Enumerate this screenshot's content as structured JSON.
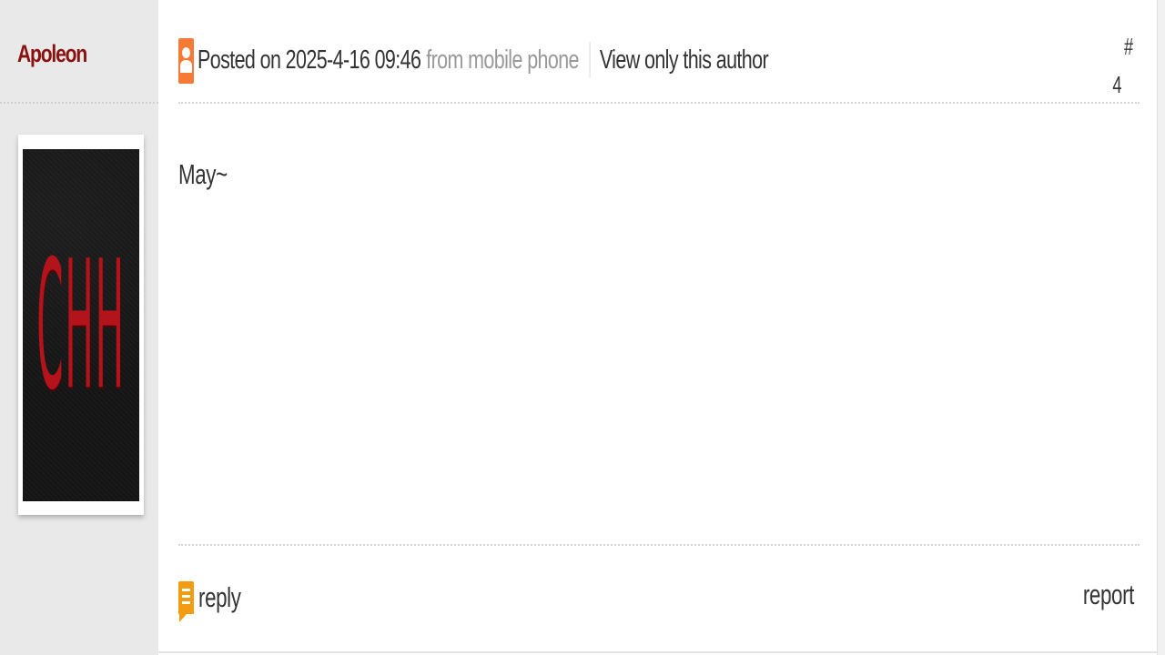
{
  "author": {
    "name": "Apoleon",
    "avatar_text": "CHH"
  },
  "post": {
    "posted_on": "Posted on 2025-4-16 09:46",
    "source": "from mobile phone",
    "view_only_author": "View only this author",
    "floor_hash": "#",
    "floor_number": "4",
    "content": "May~"
  },
  "actions": {
    "reply_label": "reply",
    "report_label": "report"
  },
  "colors": {
    "author_name": "#8b1010",
    "user_icon": "#f47a36",
    "reply_icon": "#f39c12",
    "sidebar_bg": "#e9e9e9"
  },
  "icons": {
    "header": "user-icon",
    "reply": "reply-icon"
  }
}
